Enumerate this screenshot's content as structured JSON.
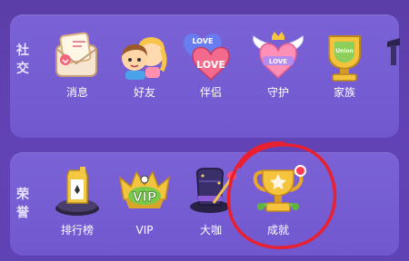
{
  "sections": {
    "social": {
      "label_1": "社",
      "label_2": "交",
      "items": [
        {
          "label": "消息",
          "icon": "envelope-icon"
        },
        {
          "label": "好友",
          "icon": "couple-icon"
        },
        {
          "label": "伴侣",
          "icon": "love-hearts-icon"
        },
        {
          "label": "守护",
          "icon": "winged-heart-icon"
        },
        {
          "label": "家族",
          "icon": "family-trophy-icon"
        }
      ]
    },
    "honor": {
      "label_1": "荣",
      "label_2": "誉",
      "items": [
        {
          "label": "排行榜",
          "icon": "leaderboard-icon"
        },
        {
          "label": "VIP",
          "icon": "vip-crown-icon"
        },
        {
          "label": "大咖",
          "icon": "top-hat-wand-icon"
        },
        {
          "label": "成就",
          "icon": "trophy-icon",
          "has_red_dot": true
        }
      ]
    }
  },
  "colors": {
    "background": "#5d3fb1",
    "panel": "#7660d4",
    "label_text": "#ffffff",
    "red_dot": "#ff3b53",
    "annotation": "#e8202f"
  }
}
